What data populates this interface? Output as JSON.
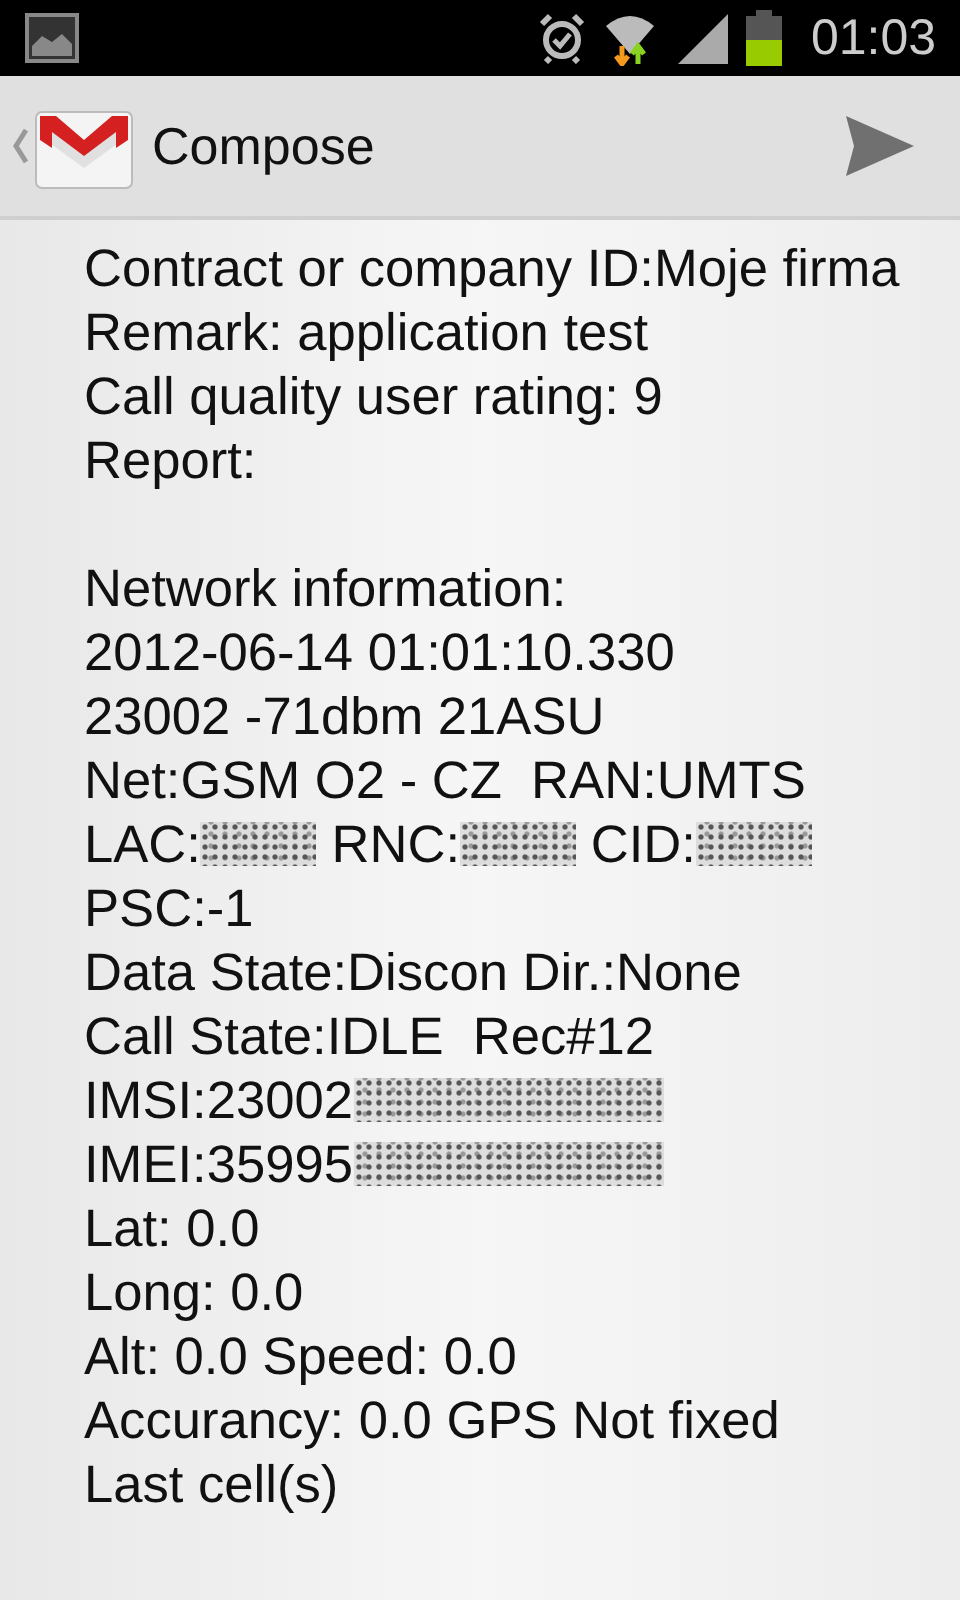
{
  "status_bar": {
    "time": "01:03"
  },
  "action_bar": {
    "title": "Compose"
  },
  "body": {
    "lines": [
      {
        "kind": "text",
        "parts": [
          {
            "kind": "text",
            "text": "Contract or company ID:Moje firma"
          }
        ]
      },
      {
        "kind": "text",
        "parts": [
          {
            "kind": "text",
            "text": "Remark: application test"
          }
        ]
      },
      {
        "kind": "text",
        "parts": [
          {
            "kind": "text",
            "text": "Call quality user rating: 9"
          }
        ]
      },
      {
        "kind": "text",
        "parts": [
          {
            "kind": "text",
            "text": "Report:"
          }
        ]
      },
      {
        "kind": "gap"
      },
      {
        "kind": "text",
        "parts": [
          {
            "kind": "text",
            "text": "Network information:"
          }
        ]
      },
      {
        "kind": "text",
        "parts": [
          {
            "kind": "text",
            "text": "2012-06-14 01:01:10.330"
          }
        ]
      },
      {
        "kind": "text",
        "parts": [
          {
            "kind": "text",
            "text": "23002 -71dbm 21ASU"
          }
        ]
      },
      {
        "kind": "text",
        "parts": [
          {
            "kind": "text",
            "text": "Net:GSM O2 - CZ  RAN:UMTS"
          }
        ]
      },
      {
        "kind": "text",
        "parts": [
          {
            "kind": "text",
            "text": "LAC:"
          },
          {
            "kind": "redacted-short"
          },
          {
            "kind": "text",
            "text": " RNC:"
          },
          {
            "kind": "redacted-short"
          },
          {
            "kind": "text",
            "text": " CID:"
          },
          {
            "kind": "redacted-short"
          }
        ]
      },
      {
        "kind": "text",
        "parts": [
          {
            "kind": "text",
            "text": "PSC:-1"
          }
        ]
      },
      {
        "kind": "text",
        "parts": [
          {
            "kind": "text",
            "text": "Data State:Discon Dir.:None"
          }
        ]
      },
      {
        "kind": "text",
        "parts": [
          {
            "kind": "text",
            "text": "Call State:IDLE  Rec#12"
          }
        ]
      },
      {
        "kind": "text",
        "parts": [
          {
            "kind": "text",
            "text": "IMSI:23002"
          },
          {
            "kind": "redacted-long"
          }
        ]
      },
      {
        "kind": "text",
        "parts": [
          {
            "kind": "text",
            "text": "IMEI:35995"
          },
          {
            "kind": "redacted-long"
          }
        ]
      },
      {
        "kind": "text",
        "parts": [
          {
            "kind": "text",
            "text": "Lat: 0.0"
          }
        ]
      },
      {
        "kind": "text",
        "parts": [
          {
            "kind": "text",
            "text": "Long: 0.0"
          }
        ]
      },
      {
        "kind": "text",
        "parts": [
          {
            "kind": "text",
            "text": "Alt: 0.0 Speed: 0.0"
          }
        ]
      },
      {
        "kind": "text",
        "parts": [
          {
            "kind": "text",
            "text": "Accurancy: 0.0 GPS Not fixed"
          }
        ]
      },
      {
        "kind": "text",
        "parts": [
          {
            "kind": "text",
            "text": "Last cell(s)"
          }
        ]
      }
    ]
  }
}
